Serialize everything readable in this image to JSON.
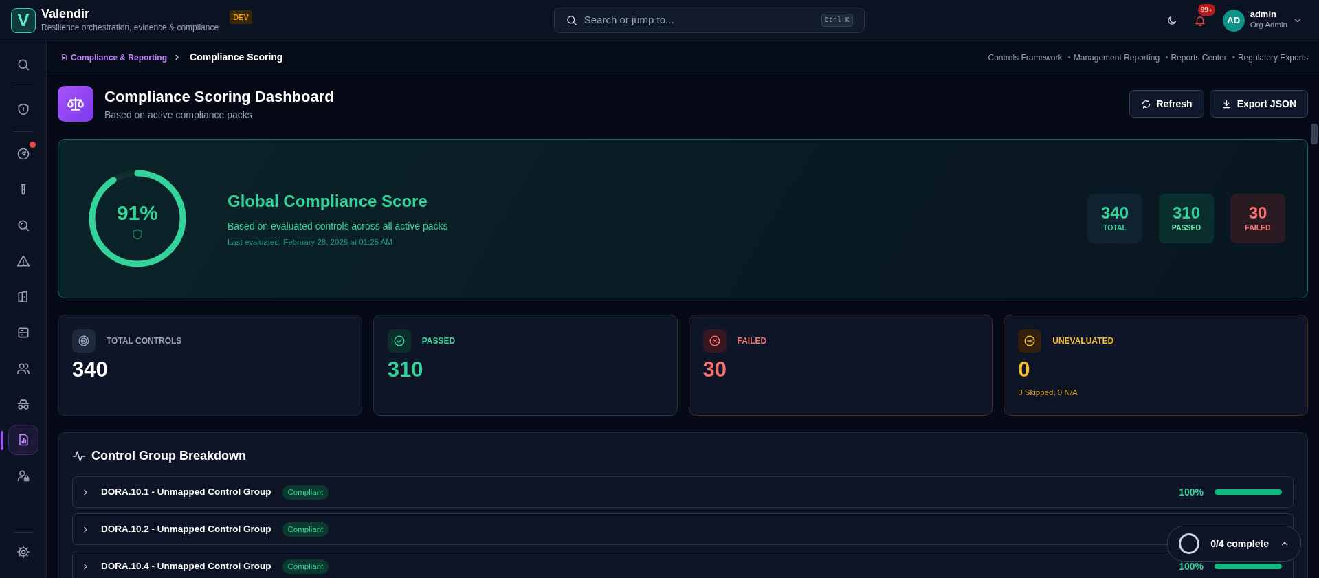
{
  "app": {
    "logo_letter": "V",
    "name": "Valendir",
    "tagline": "Resilience orchestration, evidence & compliance",
    "env_badge": "DEV"
  },
  "search": {
    "placeholder": "Search or jump to...",
    "shortcut": "Ctrl K"
  },
  "notifications": {
    "count": "99+"
  },
  "user": {
    "initials": "AD",
    "name": "admin",
    "role": "Org Admin"
  },
  "sidebar": {
    "items": [
      {
        "selected": false,
        "alert": false
      },
      {
        "selected": false,
        "alert": false
      },
      {
        "selected": false,
        "alert": true
      },
      {
        "selected": false,
        "alert": false
      },
      {
        "selected": false,
        "alert": false
      },
      {
        "selected": false,
        "alert": false
      },
      {
        "selected": false,
        "alert": false
      },
      {
        "selected": false,
        "alert": false
      },
      {
        "selected": false,
        "alert": false
      },
      {
        "selected": false,
        "alert": false
      },
      {
        "selected": true,
        "alert": false
      },
      {
        "selected": false,
        "alert": false
      }
    ]
  },
  "breadcrumb": [
    {
      "label": "Compliance & Reporting"
    },
    {
      "label": "Compliance Scoring"
    }
  ],
  "quick_link_separator": "•",
  "quick_links": [
    "Controls Framework",
    "Management Reporting",
    "Reports Center",
    "Regulatory Exports"
  ],
  "page": {
    "title": "Compliance Scoring Dashboard",
    "subtitle": "Based on active compliance packs",
    "buttons": [
      {
        "label": "Refresh"
      },
      {
        "label": "Export JSON"
      }
    ]
  },
  "score": {
    "percent": "91%",
    "level": 0.91,
    "title": "Global Compliance Score",
    "description": "Based on evaluated controls across all active packs",
    "last_evaluated": "Last evaluated: February 28, 2026 at 01:25 AM",
    "tiles": [
      {
        "kind": "total",
        "value": "340",
        "label": "TOTAL"
      },
      {
        "kind": "passed",
        "value": "310",
        "label": "PASSED"
      },
      {
        "kind": "failed",
        "value": "30",
        "label": "FAILED"
      }
    ]
  },
  "stats": [
    {
      "kind": "total",
      "label": "TOTAL CONTROLS",
      "value": "340"
    },
    {
      "kind": "passed",
      "label": "PASSED",
      "value": "310"
    },
    {
      "kind": "failed",
      "label": "FAILED",
      "value": "30"
    },
    {
      "kind": "unevaluated",
      "label": "UNEVALUATED",
      "value": "0",
      "note": "0 Skipped, 0 N/A"
    }
  ],
  "breakdown": {
    "title": "Control Group Breakdown",
    "groups": [
      {
        "name": "DORA.10.1 - Unmapped Control Group",
        "status": "Compliant",
        "percent": "100%",
        "level": 1.0,
        "expanded": false
      },
      {
        "name": "DORA.10.2 - Unmapped Control Group",
        "status": "Compliant",
        "expanded": false
      },
      {
        "name": "DORA.10.4 - Unmapped Control Group",
        "status": "Compliant",
        "percent": "100%",
        "level": 1.0,
        "expanded": false
      }
    ]
  },
  "checklist": {
    "progress": "0/4 complete",
    "expanded": false
  }
}
